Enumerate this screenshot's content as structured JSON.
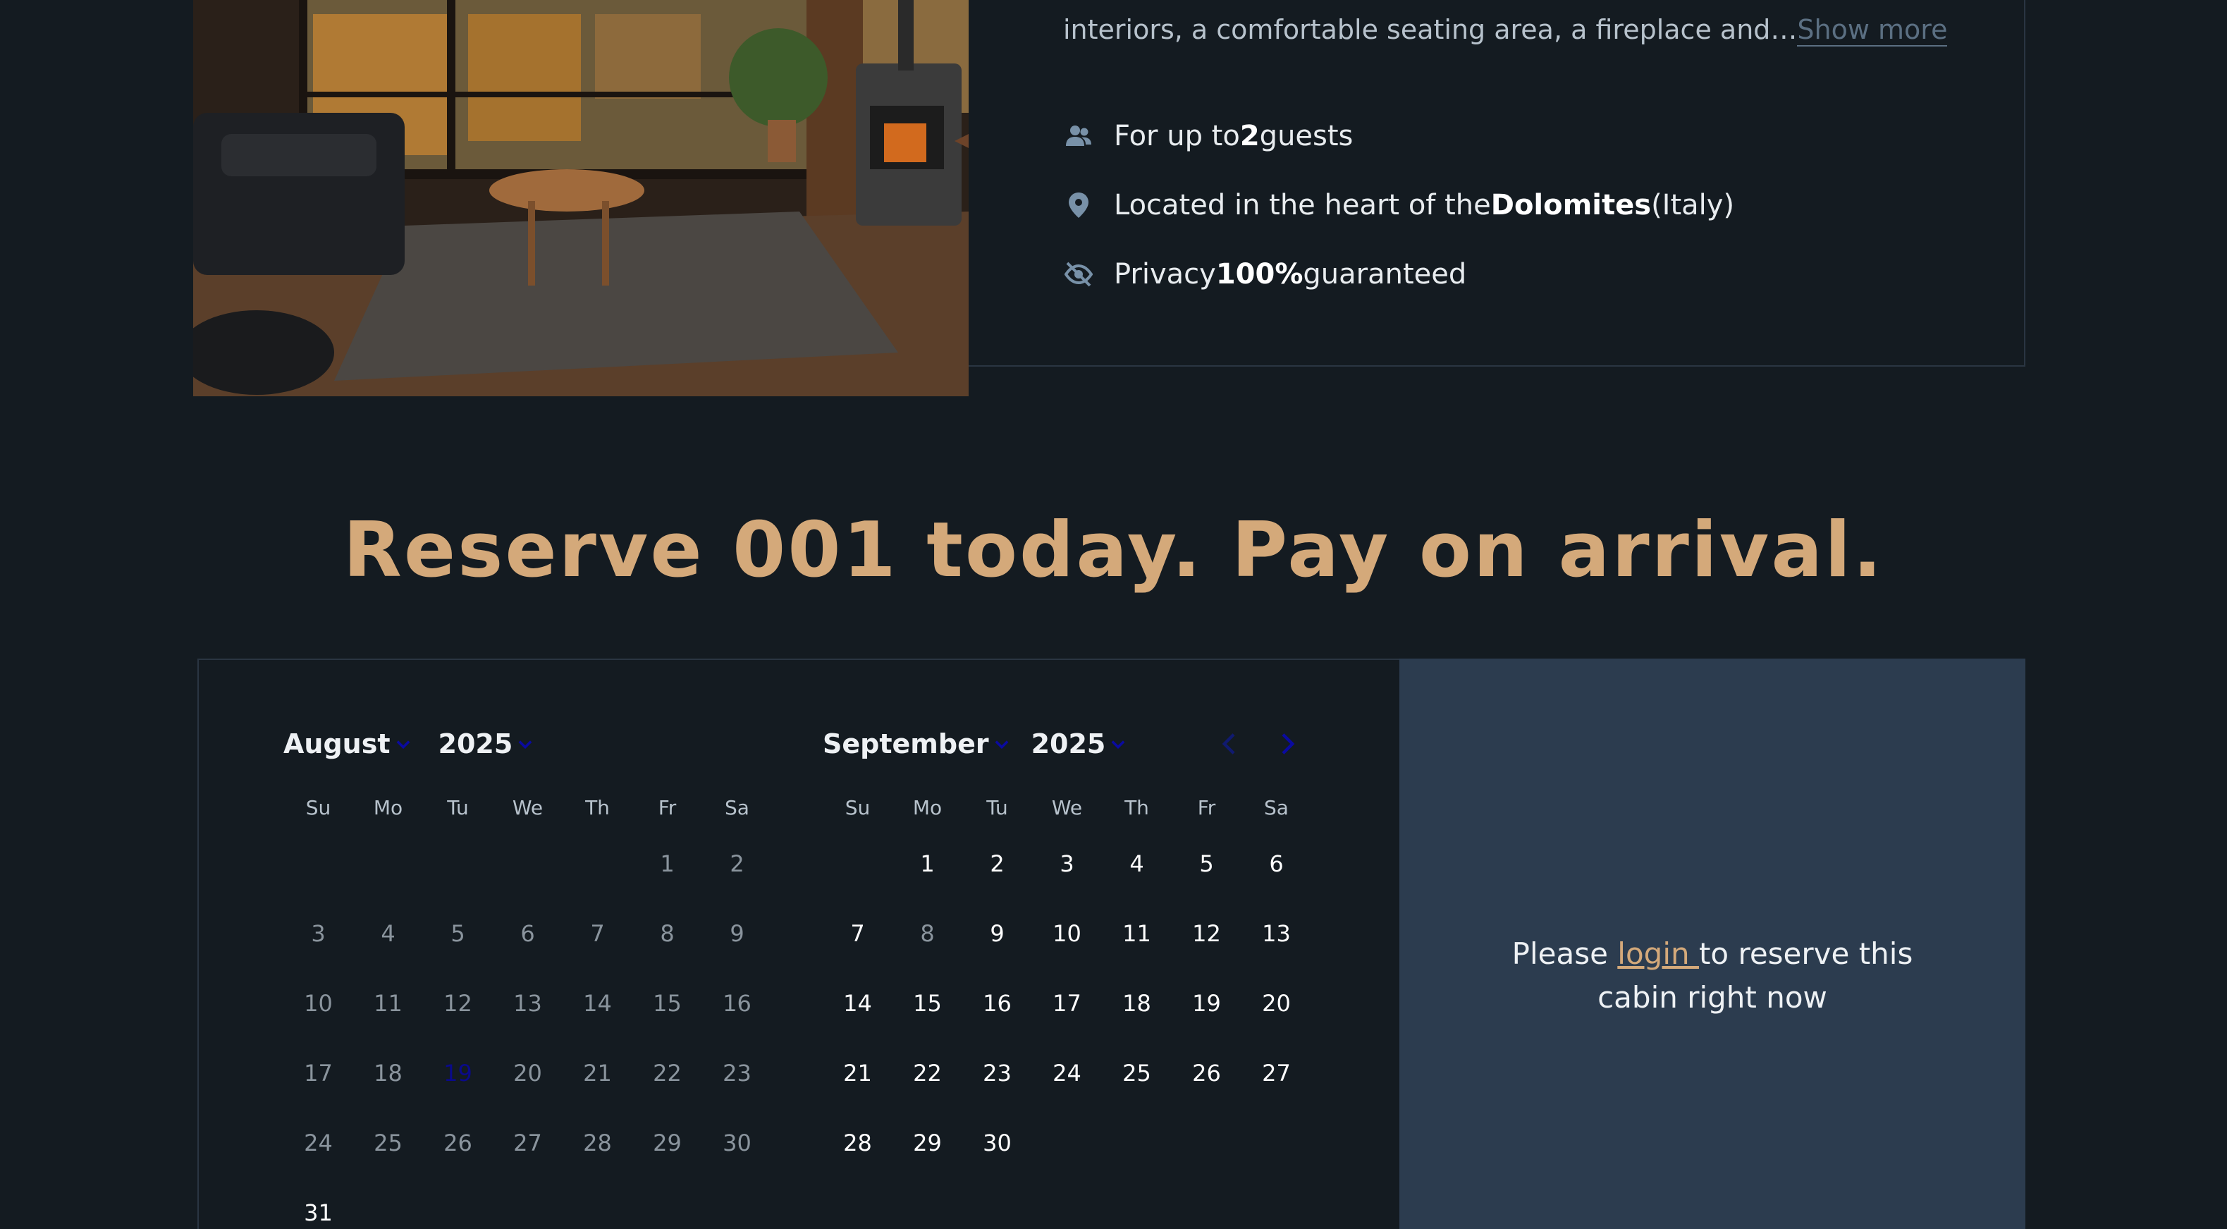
{
  "cabin": {
    "description_tail": "interiors, a comfortable seating area, a fireplace and…",
    "show_more": "Show more",
    "features": [
      {
        "icon": "guests-icon",
        "pre": "For up to ",
        "bold": "2",
        "post": " guests"
      },
      {
        "icon": "location-pin-icon",
        "pre": "Located in the heart of the",
        "bold": "Dolomites",
        "post": " (Italy)"
      },
      {
        "icon": "eye-slash-icon",
        "pre": "Privacy ",
        "bold": "100%",
        "post": " guaranteed"
      }
    ]
  },
  "reserve": {
    "title": "Reserve 001 today. Pay on arrival."
  },
  "calendar": {
    "weekdays": [
      "Su",
      "Mo",
      "Tu",
      "We",
      "Th",
      "Fr",
      "Sa"
    ],
    "months": [
      {
        "month": "August",
        "year": "2025",
        "weeks": [
          [
            null,
            null,
            null,
            null,
            null,
            {
              "d": "1",
              "s": "past"
            },
            {
              "d": "2",
              "s": "past"
            }
          ],
          [
            {
              "d": "3",
              "s": "past"
            },
            {
              "d": "4",
              "s": "past"
            },
            {
              "d": "5",
              "s": "past"
            },
            {
              "d": "6",
              "s": "past"
            },
            {
              "d": "7",
              "s": "past"
            },
            {
              "d": "8",
              "s": "past"
            },
            {
              "d": "9",
              "s": "past"
            }
          ],
          [
            {
              "d": "10",
              "s": "past"
            },
            {
              "d": "11",
              "s": "past"
            },
            {
              "d": "12",
              "s": "past"
            },
            {
              "d": "13",
              "s": "past"
            },
            {
              "d": "14",
              "s": "past"
            },
            {
              "d": "15",
              "s": "past"
            },
            {
              "d": "16",
              "s": "past"
            }
          ],
          [
            {
              "d": "17",
              "s": "past"
            },
            {
              "d": "18",
              "s": "past"
            },
            {
              "d": "19",
              "s": "today"
            },
            {
              "d": "20",
              "s": "past"
            },
            {
              "d": "21",
              "s": "past"
            },
            {
              "d": "22",
              "s": "past"
            },
            {
              "d": "23",
              "s": "past"
            }
          ],
          [
            {
              "d": "24",
              "s": "past"
            },
            {
              "d": "25",
              "s": "past"
            },
            {
              "d": "26",
              "s": "past"
            },
            {
              "d": "27",
              "s": "past"
            },
            {
              "d": "28",
              "s": "past"
            },
            {
              "d": "29",
              "s": "past"
            },
            {
              "d": "30",
              "s": "past"
            }
          ],
          [
            {
              "d": "31",
              "s": "avail"
            },
            null,
            null,
            null,
            null,
            null,
            null
          ]
        ]
      },
      {
        "month": "September",
        "year": "2025",
        "weeks": [
          [
            null,
            {
              "d": "1",
              "s": "avail"
            },
            {
              "d": "2",
              "s": "avail"
            },
            {
              "d": "3",
              "s": "avail"
            },
            {
              "d": "4",
              "s": "avail"
            },
            {
              "d": "5",
              "s": "avail"
            },
            {
              "d": "6",
              "s": "avail"
            }
          ],
          [
            {
              "d": "7",
              "s": "avail"
            },
            {
              "d": "8",
              "s": "past"
            },
            {
              "d": "9",
              "s": "avail"
            },
            {
              "d": "10",
              "s": "avail"
            },
            {
              "d": "11",
              "s": "avail"
            },
            {
              "d": "12",
              "s": "avail"
            },
            {
              "d": "13",
              "s": "avail"
            }
          ],
          [
            {
              "d": "14",
              "s": "avail"
            },
            {
              "d": "15",
              "s": "avail"
            },
            {
              "d": "16",
              "s": "avail"
            },
            {
              "d": "17",
              "s": "avail"
            },
            {
              "d": "18",
              "s": "avail"
            },
            {
              "d": "19",
              "s": "avail"
            },
            {
              "d": "20",
              "s": "avail"
            }
          ],
          [
            {
              "d": "21",
              "s": "avail"
            },
            {
              "d": "22",
              "s": "avail"
            },
            {
              "d": "23",
              "s": "avail"
            },
            {
              "d": "24",
              "s": "avail"
            },
            {
              "d": "25",
              "s": "avail"
            },
            {
              "d": "26",
              "s": "avail"
            },
            {
              "d": "27",
              "s": "avail"
            }
          ],
          [
            {
              "d": "28",
              "s": "avail"
            },
            {
              "d": "29",
              "s": "avail"
            },
            {
              "d": "30",
              "s": "avail"
            },
            null,
            null,
            null,
            null
          ]
        ]
      }
    ],
    "nav": {
      "prev_icon": "chevron-left-icon",
      "next_icon": "chevron-right-icon"
    }
  },
  "login_prompt": {
    "before": "Please ",
    "link": "login ",
    "after": "to reserve this cabin right now"
  },
  "colors": {
    "background": "#141b21",
    "accent": "#d4a97a",
    "panel": "#2c3c4f",
    "chevron": "#0a0aa0"
  }
}
